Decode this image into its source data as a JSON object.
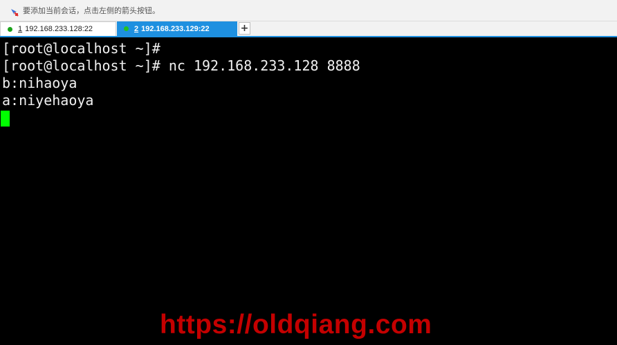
{
  "hint_bar": {
    "text": "要添加当前会话，点击左侧的箭头按钮。",
    "icon": "session-add-arrow-icon"
  },
  "tabs": [
    {
      "number": "1",
      "label": "192.168.233.128:22",
      "active": false,
      "status_color": "#1aa31a"
    },
    {
      "number": "2",
      "label": "192.168.233.129:22",
      "active": true,
      "status_color": "#22c022"
    }
  ],
  "tab_add_label": "+",
  "terminal": {
    "lines": [
      "[root@localhost ~]#",
      "[root@localhost ~]# nc 192.168.233.128 8888",
      "b:nihaoya",
      "a:niyehaoya"
    ],
    "cursor_color": "#00ff00",
    "background": "#000000",
    "foreground": "#f0f0f0"
  },
  "watermark": "https://oldqiang.com",
  "colors": {
    "accent": "#1e90e0",
    "watermark": "#c40000"
  }
}
